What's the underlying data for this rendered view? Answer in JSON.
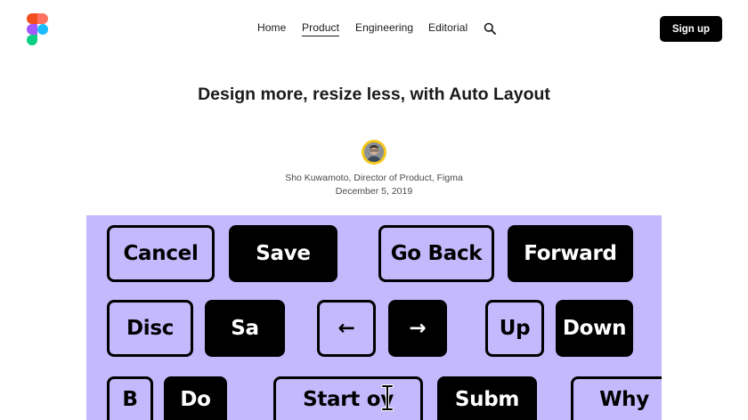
{
  "nav": {
    "items": [
      {
        "label": "Home"
      },
      {
        "label": "Product"
      },
      {
        "label": "Engineering"
      },
      {
        "label": "Editorial"
      }
    ],
    "active": "Product"
  },
  "header": {
    "signup_label": "Sign up",
    "logo_icon": "figma-logo-icon",
    "search_icon": "search-icon"
  },
  "article": {
    "title": "Design more, resize less, with Auto Layout",
    "author": "Sho Kuwamoto, Director of Product, Figma",
    "date": "December 5, 2019"
  },
  "hero": {
    "keys": [
      {
        "label": "Cancel",
        "style": "light"
      },
      {
        "label": "Save",
        "style": "dark"
      },
      {
        "label": "Go Back",
        "style": "light"
      },
      {
        "label": "Forward",
        "style": "dark"
      },
      {
        "label": "Disc",
        "style": "light"
      },
      {
        "label": "Sa",
        "style": "dark"
      },
      {
        "label": "←",
        "style": "light"
      },
      {
        "label": "→",
        "style": "dark"
      },
      {
        "label": "Up",
        "style": "light"
      },
      {
        "label": "Down",
        "style": "dark"
      },
      {
        "label": "B",
        "style": "light"
      },
      {
        "label": "Do",
        "style": "dark"
      },
      {
        "label": "Start ov",
        "style": "light"
      },
      {
        "label": "Subm",
        "style": "dark"
      },
      {
        "label": "Why",
        "style": "light"
      }
    ]
  },
  "colors": {
    "hero_bg": "#c5b9fd",
    "button_dark": "#000000",
    "avatar_ring": "#f4c81a"
  }
}
